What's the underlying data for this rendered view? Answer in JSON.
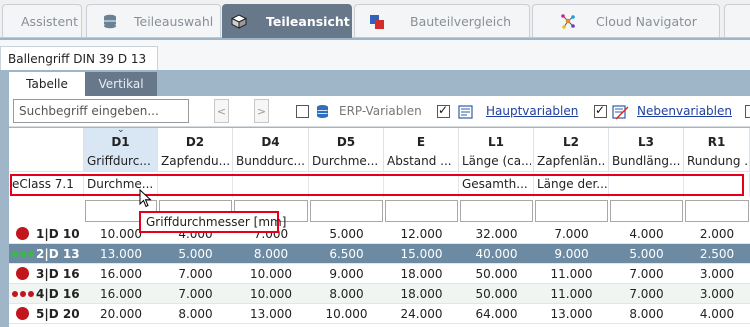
{
  "tabs": [
    {
      "label": "Assistent",
      "active": false,
      "icon": "none"
    },
    {
      "label": "Teileauswahl",
      "active": false,
      "icon": "database-stack-icon"
    },
    {
      "label": "Teileansicht",
      "active": true,
      "icon": "cube-icon"
    },
    {
      "label": "Bauteilvergleich",
      "active": false,
      "icon": "compare-parts-icon"
    },
    {
      "label": "Cloud Navigator",
      "active": false,
      "icon": "cloud-network-icon"
    }
  ],
  "document_tab": "Ballengriff DIN 39 D 13",
  "subtabs": {
    "tabelle": "Tabelle",
    "vertikal": "Vertikal"
  },
  "toolbar": {
    "search_placeholder": "Suchbegriff eingeben...",
    "prev": "<",
    "next": ">",
    "erp_label": "ERP-Variablen",
    "erp_checked": false,
    "haupt_label": "Hauptvariablen",
    "haupt_checked": true,
    "neben_label": "Nebenvariablen",
    "neben_checked": true
  },
  "columns": [
    {
      "code": "D1",
      "desc": "Griffdurc...",
      "eclass": "Durchme..."
    },
    {
      "code": "D2",
      "desc": "Zapfendu...",
      "eclass": ""
    },
    {
      "code": "D4",
      "desc": "Bunddurc...",
      "eclass": ""
    },
    {
      "code": "D5",
      "desc": "Durchme...",
      "eclass": ""
    },
    {
      "code": "E",
      "desc": "Abstand ...",
      "eclass": ""
    },
    {
      "code": "L1",
      "desc": "Länge (ca...",
      "eclass": "Gesamth..."
    },
    {
      "code": "L2",
      "desc": "Zapfenlän...",
      "eclass": "Länge der..."
    },
    {
      "code": "L3",
      "desc": "Bundläng...",
      "eclass": ""
    },
    {
      "code": "R1",
      "desc": "Rundung ...",
      "eclass": ""
    }
  ],
  "eclass_label": "eClass 7.1",
  "tooltip": "Griffdurchmesser [mm]",
  "rows": [
    {
      "label": "1|D 10",
      "status": "red",
      "values": [
        "10.000",
        "4.000",
        "7.000",
        "5.000",
        "12.000",
        "32.000",
        "7.000",
        "4.000",
        "2.000"
      ]
    },
    {
      "label": "2|D 13",
      "status": "green-dots",
      "selected": true,
      "values": [
        "13.000",
        "5.000",
        "8.000",
        "6.500",
        "15.000",
        "40.000",
        "9.000",
        "5.000",
        "2.500"
      ]
    },
    {
      "label": "3|D 16",
      "status": "red",
      "values": [
        "16.000",
        "7.000",
        "10.000",
        "9.000",
        "18.000",
        "50.000",
        "11.000",
        "7.000",
        "3.000"
      ]
    },
    {
      "label": "4|D 16",
      "status": "red-dots",
      "values": [
        "16.000",
        "7.000",
        "10.000",
        "8.000",
        "18.000",
        "50.000",
        "11.000",
        "7.000",
        "3.000"
      ]
    },
    {
      "label": "5|D 20",
      "status": "red",
      "values": [
        "20.000",
        "8.000",
        "13.000",
        "10.000",
        "24.000",
        "64.000",
        "13.000",
        "8.000",
        "4.000"
      ]
    }
  ],
  "colors": {
    "accent": "#66788a",
    "highlight": "#e4001b",
    "selected_row": "#6d8aa3",
    "status_red": "#c0161c",
    "status_green": "#3cb84a"
  }
}
